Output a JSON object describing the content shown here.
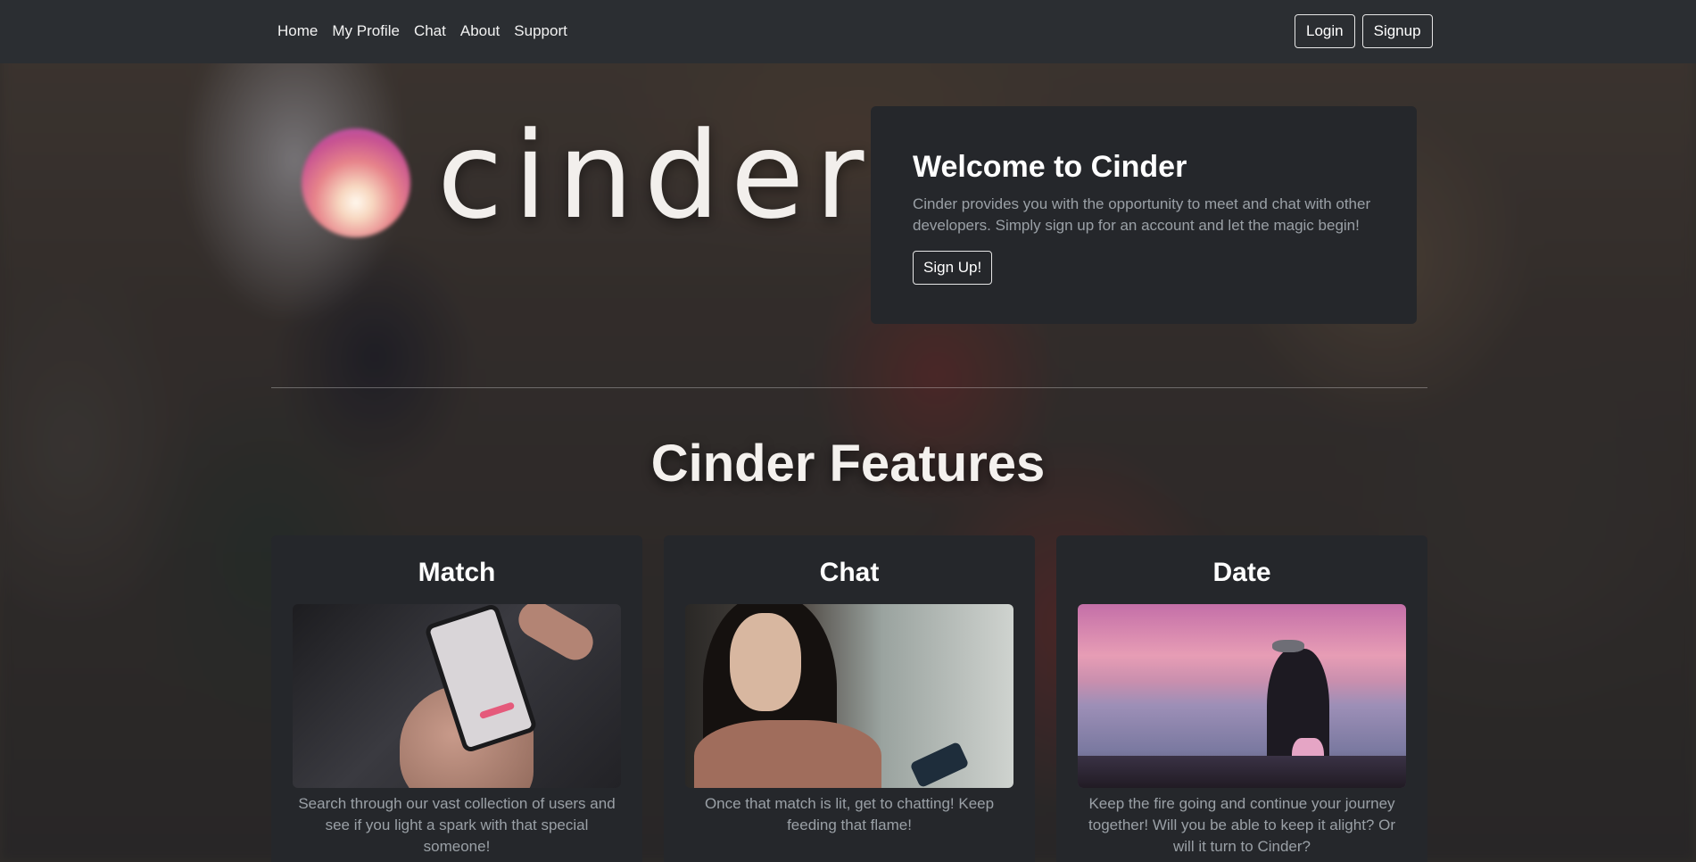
{
  "nav": {
    "links": [
      "Home",
      "My Profile",
      "Chat",
      "About",
      "Support"
    ],
    "login_label": "Login",
    "signup_label": "Signup"
  },
  "hero": {
    "logo_text": "cinder",
    "welcome_title": "Welcome to Cinder",
    "welcome_text": "Cinder provides you with the opportunity to meet and chat with other developers. Simply sign up for an account and let the magic begin!",
    "welcome_button": "Sign Up!"
  },
  "features": {
    "title": "Cinder Features",
    "cards": [
      {
        "title": "Match",
        "text": "Search through our vast collection of users and see if you light a spark with that special someone!"
      },
      {
        "title": "Chat",
        "text": "Once that match is lit, get to chatting! Keep feeding that flame!"
      },
      {
        "title": "Date",
        "text": "Keep the fire going and continue your journey together! Will you be able to keep it alight? Or will it turn to Cinder?"
      }
    ]
  },
  "colors": {
    "navbar": "#2b2e32",
    "card": "#25272b",
    "muted_text": "#9aa0a6"
  }
}
